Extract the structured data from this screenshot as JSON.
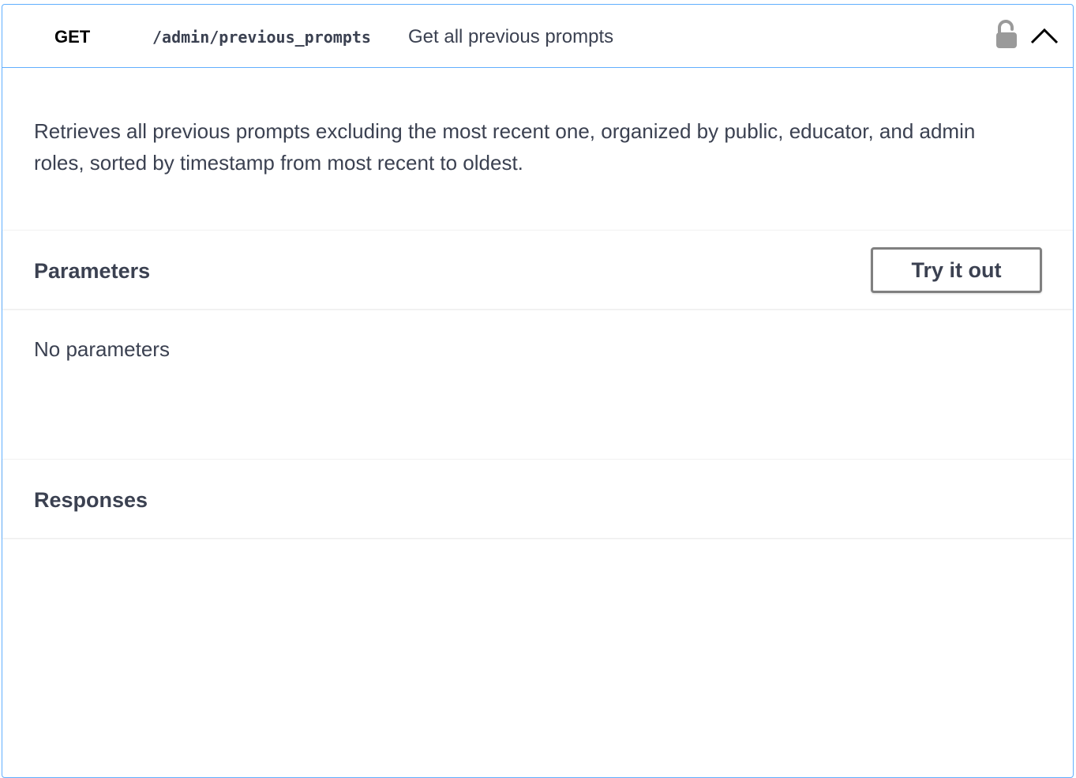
{
  "operation": {
    "method": "GET",
    "path": "/admin/previous_prompts",
    "summary": "Get all previous prompts",
    "lock_icon": "unlock-icon",
    "collapse_icon": "chevron-up-icon",
    "accent_color": "#61affe"
  },
  "description": "Retrieves all previous prompts excluding the most recent one, organized by public, educator, and admin roles, sorted by timestamp from most recent to oldest.",
  "parameters": {
    "title": "Parameters",
    "try_it_out_label": "Try it out",
    "empty_text": "No parameters"
  },
  "responses": {
    "title": "Responses"
  }
}
